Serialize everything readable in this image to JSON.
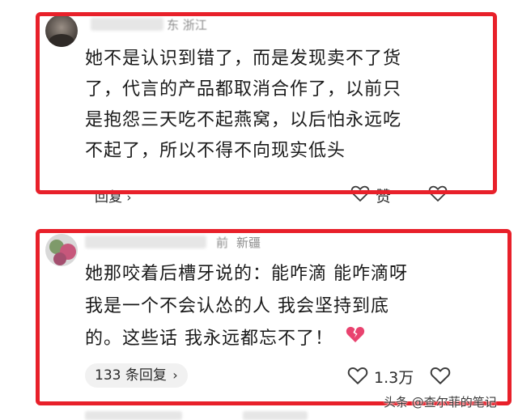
{
  "comment1": {
    "author_meta": "东 浙江",
    "lines": [
      "她不是认识到错了，而是发现卖不了货",
      "了，代言的产品都取消合作了，以前只",
      "是抱怨三天吃不起燕窝，以后怕永远吃",
      "不起了，所以不得不向现实低头"
    ],
    "reply_label": "回复",
    "like_label": "赞"
  },
  "comment2": {
    "time_meta": "前",
    "region": "新疆",
    "lines": [
      "她那咬着后槽牙说的：能咋滴 能咋滴呀",
      "我是一个不会认怂的人 我会坚持到底",
      "的。这些话 我永远都忘不了！"
    ],
    "replies_label": "133 条回复",
    "like_count": "1.3万"
  },
  "watermark": "头条 @查尔菲的笔记",
  "colors": {
    "highlight_border": "#e8202a",
    "broken_heart": "#e9436f"
  },
  "icons": [
    "heart-outline-icon",
    "broken-heart-emoji",
    "chevron-right-icon"
  ]
}
